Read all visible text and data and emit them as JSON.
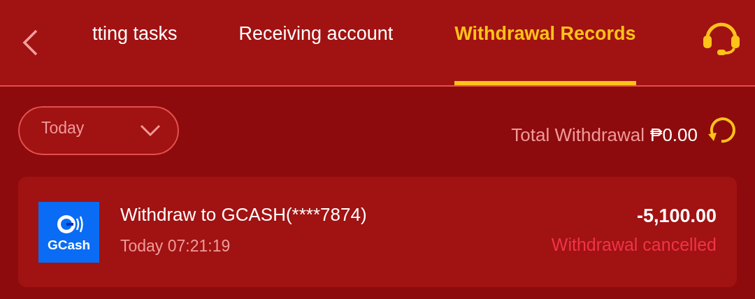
{
  "tabs": [
    {
      "label": "tting tasks",
      "selected": false
    },
    {
      "label": "Receiving account",
      "selected": false
    },
    {
      "label": "Withdrawal Records",
      "selected": true
    }
  ],
  "filter": {
    "value": "Today"
  },
  "total": {
    "label": "Total Withdrawal",
    "amount": "₱0.00"
  },
  "records": [
    {
      "logo_label": "GCash",
      "title": "Withdraw to GCASH(****7874)",
      "time": "Today 07:21:19",
      "amount": "-5,100.00",
      "status": "Withdrawal cancelled",
      "cancelled": true
    }
  ]
}
